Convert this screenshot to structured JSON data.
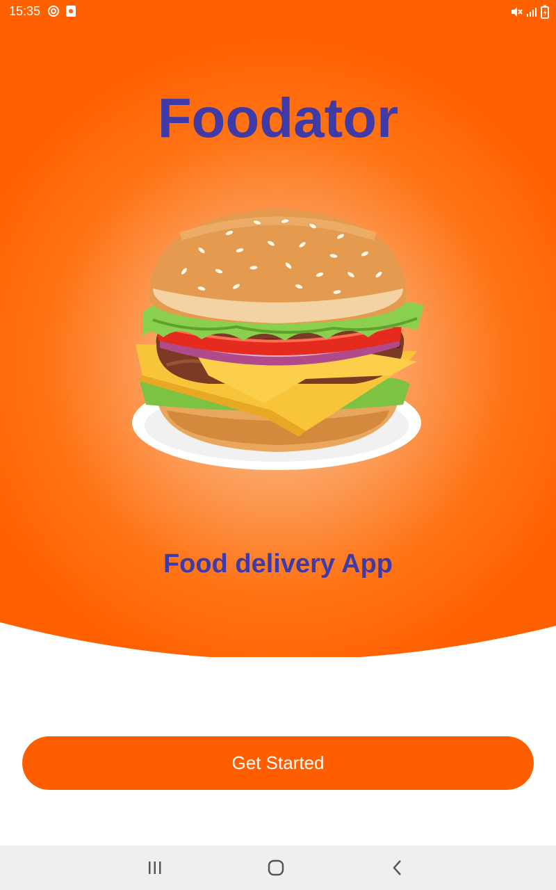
{
  "status_bar": {
    "time": "15:35",
    "left_icons": [
      "at-icon",
      "photo-notification-icon"
    ],
    "right_icons": [
      "mute-icon",
      "signal-icon",
      "battery-icon"
    ]
  },
  "app": {
    "title": "Foodator",
    "tagline": "Food delivery App",
    "hero_image": "burger-icon",
    "cta_label": "Get Started"
  },
  "colors": {
    "accent": "#FF5E00",
    "title_color": "#3F3AA6",
    "hero_center": "#FBC89A"
  },
  "nav_bar": {
    "buttons": [
      "recent-apps-icon",
      "home-icon",
      "back-icon"
    ]
  }
}
